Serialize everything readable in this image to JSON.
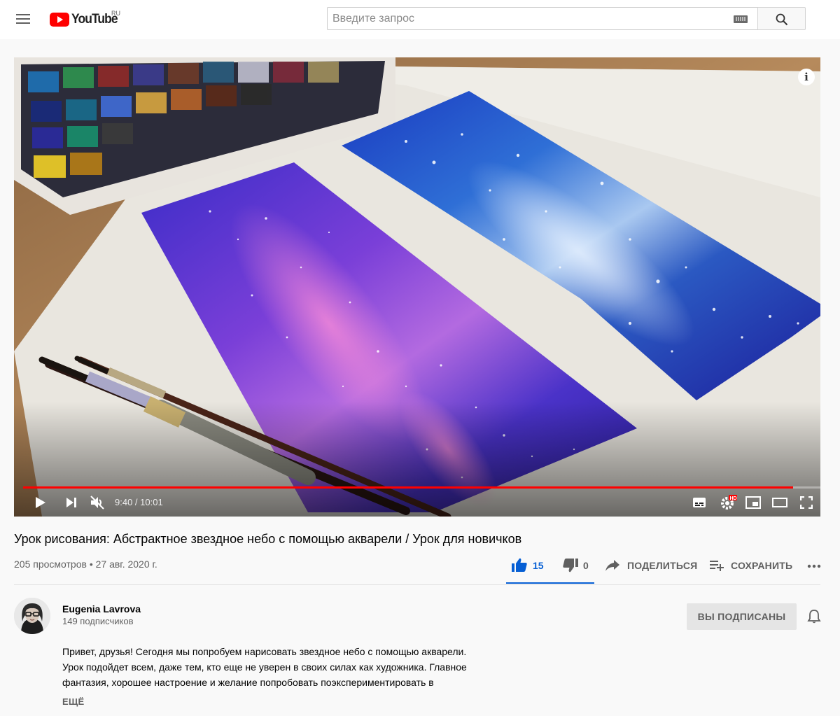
{
  "header": {
    "logo_text": "YouTube",
    "region": "RU",
    "search_placeholder": "Введите запрос"
  },
  "player": {
    "time_current": "9:40",
    "time_separator": " / ",
    "time_total": "10:01",
    "progress_fraction": 0.966,
    "info_glyph": "i",
    "icons": [
      "play-icon",
      "next-icon",
      "mute-icon",
      "subtitles-icon",
      "settings-hd-icon",
      "miniplayer-icon",
      "theater-icon",
      "fullscreen-icon"
    ]
  },
  "video": {
    "title": "Урок рисования: Абстрактное звездное небо с помощью акварели / Урок для новичков",
    "views": "205 просмотров",
    "separator": " • ",
    "date": "27 авг. 2020 г."
  },
  "actions": {
    "likes": "15",
    "dislikes": "0",
    "share_label": "ПОДЕЛИТЬСЯ",
    "save_label": "СОХРАНИТЬ",
    "like_ratio": 1.0,
    "accent_color": "#065fd4"
  },
  "channel": {
    "name": "Eugenia Lavrova",
    "subscribers": "149 подписчиков",
    "subscribed_label": "ВЫ ПОДПИСАНЫ"
  },
  "description": {
    "lines": [
      "Привет, друзья! Сегодня мы попробуем нарисовать звездное небо с помощью акварели.",
      "Урок подойдет всем, даже тем, кто еще не уверен в своих силах как художника. Главное",
      "фантазия, хорошее настроение и желание попробовать поэкспериментировать в"
    ],
    "more_label": "ЕЩЁ"
  }
}
